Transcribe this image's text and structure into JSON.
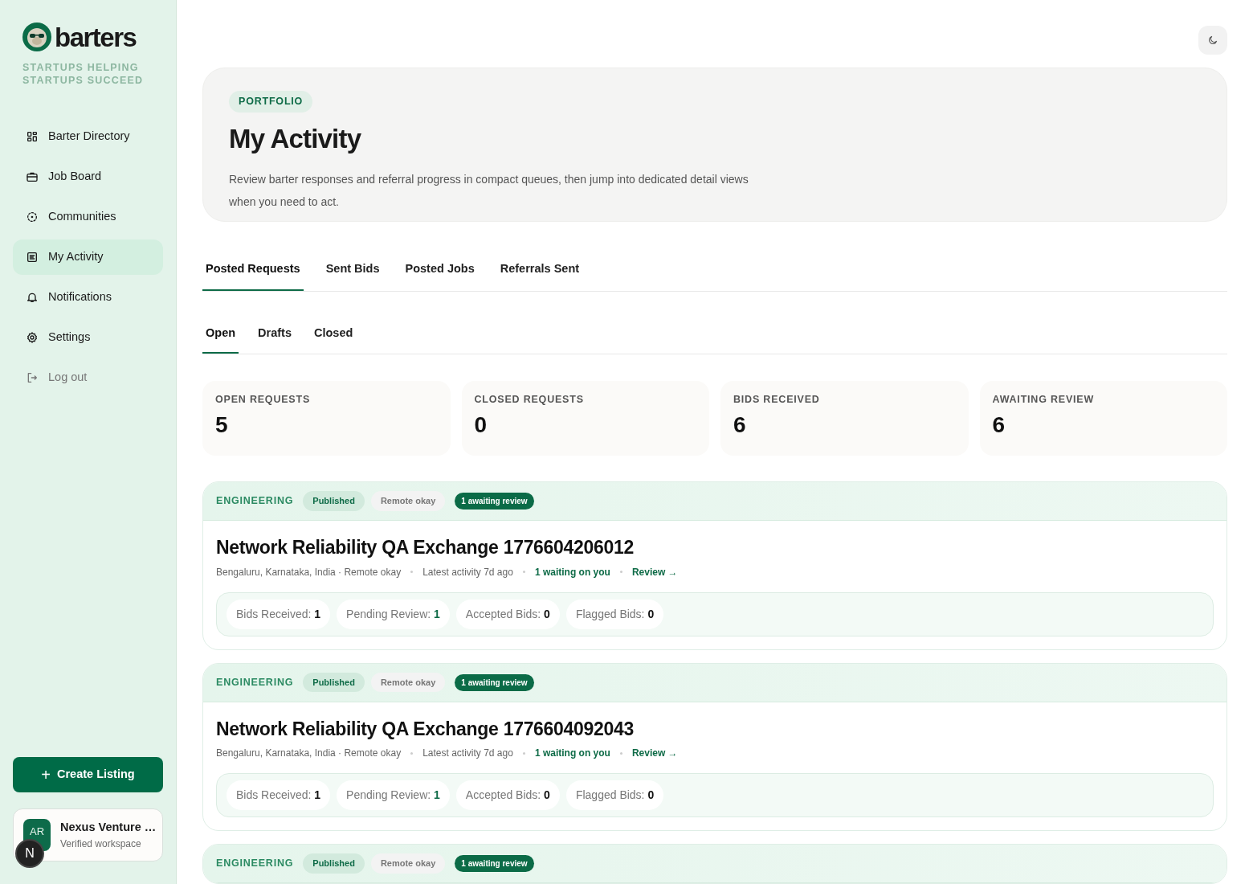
{
  "brand": {
    "name": "barters",
    "tagline": "STARTUPS HELPING STARTUPS SUCCEED"
  },
  "nav": [
    {
      "label": "Barter Directory",
      "selected": false,
      "muted": false
    },
    {
      "label": "Job Board",
      "selected": false,
      "muted": false
    },
    {
      "label": "Communities",
      "selected": false,
      "muted": false
    },
    {
      "label": "My Activity",
      "selected": true,
      "muted": false
    },
    {
      "label": "Notifications",
      "selected": false,
      "muted": false
    },
    {
      "label": "Settings",
      "selected": false,
      "muted": false
    },
    {
      "label": "Log out",
      "selected": false,
      "muted": true
    }
  ],
  "create_button": {
    "icon": "+",
    "label": "Create Listing"
  },
  "workspace": {
    "initials": "AR",
    "badge": "N",
    "name": "Nexus Venture …",
    "subtitle": "Verified workspace"
  },
  "header": {
    "eyebrow": "PORTFOLIO",
    "title": "My Activity",
    "description": "Review barter responses and referral progress in compact queues, then jump into dedicated detail views when you need to act."
  },
  "tabs": [
    {
      "label": "Posted Requests",
      "selected": true
    },
    {
      "label": "Sent Bids",
      "selected": false
    },
    {
      "label": "Posted Jobs",
      "selected": false
    },
    {
      "label": "Referrals Sent",
      "selected": false
    }
  ],
  "subtabs": [
    {
      "label": "Open",
      "selected": true
    },
    {
      "label": "Drafts",
      "selected": false
    },
    {
      "label": "Closed",
      "selected": false
    }
  ],
  "stats": [
    {
      "label": "OPEN REQUESTS",
      "value": "5"
    },
    {
      "label": "CLOSED REQUESTS",
      "value": "0"
    },
    {
      "label": "BIDS RECEIVED",
      "value": "6"
    },
    {
      "label": "AWAITING REVIEW",
      "value": "6"
    }
  ],
  "requests": [
    {
      "category": "ENGINEERING",
      "status": "Published",
      "mode": "Remote okay",
      "badge": "1 awaiting review",
      "title": "Network Reliability QA Exchange 1776604206012",
      "location": "Bengaluru, Karnataka, India · Remote okay",
      "activity": "Latest activity 7d ago",
      "waiting": "1 waiting on you",
      "action": "Review →",
      "counts": [
        {
          "label": "Bids Received:",
          "value": "1",
          "accent": false
        },
        {
          "label": "Pending Review:",
          "value": "1",
          "accent": true
        },
        {
          "label": "Accepted Bids:",
          "value": "0",
          "accent": false
        },
        {
          "label": "Flagged Bids:",
          "value": "0",
          "accent": false
        }
      ]
    },
    {
      "category": "ENGINEERING",
      "status": "Published",
      "mode": "Remote okay",
      "badge": "1 awaiting review",
      "title": "Network Reliability QA Exchange 1776604092043",
      "location": "Bengaluru, Karnataka, India · Remote okay",
      "activity": "Latest activity 7d ago",
      "waiting": "1 waiting on you",
      "action": "Review →",
      "counts": [
        {
          "label": "Bids Received:",
          "value": "1",
          "accent": false
        },
        {
          "label": "Pending Review:",
          "value": "1",
          "accent": true
        },
        {
          "label": "Accepted Bids:",
          "value": "0",
          "accent": false
        },
        {
          "label": "Flagged Bids:",
          "value": "0",
          "accent": false
        }
      ]
    },
    {
      "category": "ENGINEERING",
      "status": "Published",
      "mode": "Remote okay",
      "badge": "1 awaiting review"
    }
  ]
}
